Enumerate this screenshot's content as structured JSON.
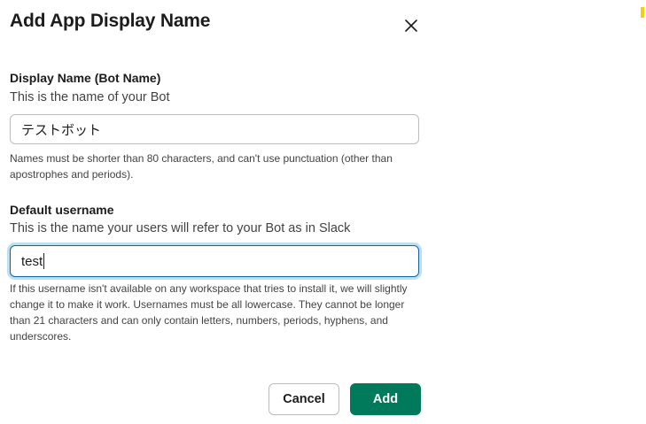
{
  "modal": {
    "title": "Add App Display Name",
    "close_icon": "close-icon"
  },
  "display_name": {
    "label": "Display Name (Bot Name)",
    "description": "This is the name of your Bot",
    "value": "テストボット",
    "hint": "Names must be shorter than 80 characters, and can't use punctuation (other than apostrophes and periods)."
  },
  "username": {
    "label": "Default username",
    "description": "This is the name your users will refer to your Bot as in Slack",
    "value": "test",
    "hint": "If this username isn't available on any workspace that tries to install it, we will slightly change it to make it work. Usernames must be all lowercase. They cannot be longer than 21 characters and can only contain letters, numbers, periods, hyphens, and underscores."
  },
  "buttons": {
    "cancel_label": "Cancel",
    "add_label": "Add"
  },
  "colors": {
    "primary_button": "#007a5a",
    "focus_ring": "#1264a3",
    "edge_mark": "#f2d10b"
  }
}
